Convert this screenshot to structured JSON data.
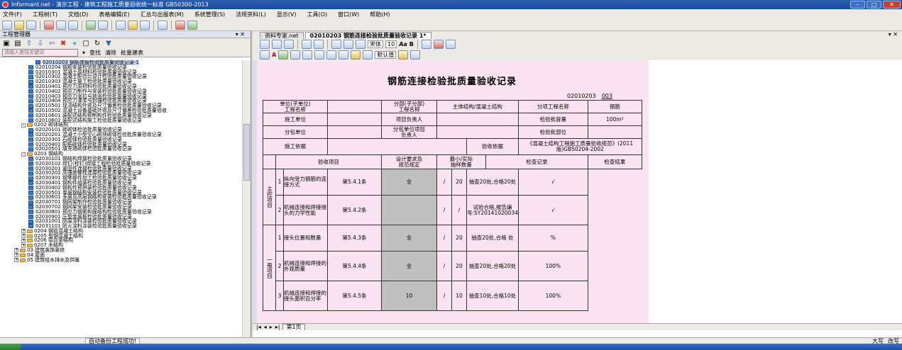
{
  "window": {
    "title": "Informant.net - 演示工程 - 建筑工程施工质量验收统一标准 GB50300-2013"
  },
  "menu": [
    "文件(F)",
    "工程树(T)",
    "文档(D)",
    "表格编辑(E)",
    "汇总与出报表(M)",
    "系统管理(S)",
    "法规资料(L)",
    "显示(V)",
    "工具(O)",
    "窗口(W)",
    "帮助(H)"
  ],
  "left": {
    "title": "工程管理器",
    "search_placeholder": "请输入查找关键词",
    "find_label": "查找",
    "clear_label": "清除",
    "batch_label": "批量建表",
    "tree": [
      {
        "t": "02010203  钢筋连接检验批质量验收记录-1",
        "lvl": 5,
        "sel": true,
        "k": "doc"
      },
      {
        "t": "02010204  钢筋安装检验批质量验收记录",
        "lvl": 4,
        "k": "doc"
      },
      {
        "t": "02010301  混凝土原材料检验批质量验收记录",
        "lvl": 4,
        "k": "doc"
      },
      {
        "t": "02010302  混凝土配合比设计检验批质量验收记录",
        "lvl": 4,
        "k": "doc"
      },
      {
        "t": "02010303  混凝土施工检验批质量验收记录",
        "lvl": 4,
        "k": "doc"
      },
      {
        "t": "02010401  预应力原材料检验批质量验收记录",
        "lvl": 4,
        "k": "doc"
      },
      {
        "t": "02010402  预应力制作与安装检验批质量验收记录",
        "lvl": 4,
        "k": "doc"
      },
      {
        "t": "02010403  预应力张拉与放张检验批质量验收记录",
        "lvl": 4,
        "k": "doc"
      },
      {
        "t": "02010404  预应力灌浆与封锚检验批质量验收记录",
        "lvl": 4,
        "k": "doc"
      },
      {
        "t": "02010501  现浇结构外观及尺寸偏差检验批质量验收记录",
        "lvl": 4,
        "k": "doc"
      },
      {
        "t": "02010502  混凝土设备基础外观及尺寸偏差检验批质量验收",
        "lvl": 4,
        "k": "doc"
      },
      {
        "t": "02010601  装配式结构预制构件检验批质量验收记录",
        "lvl": 4,
        "k": "doc"
      },
      {
        "t": "02010602  装配式结构施工检验批质量验收记录",
        "lvl": 4,
        "k": "doc"
      },
      {
        "t": "0202  砌体结构",
        "lvl": 3,
        "k": "folder",
        "pm": "-"
      },
      {
        "t": "02020101  砖砌体检验批质量验收记录",
        "lvl": 4,
        "k": "doc"
      },
      {
        "t": "02020201  混凝土小型空心砌块砌体检验批质量验收记录",
        "lvl": 4,
        "k": "doc"
      },
      {
        "t": "02020301  石砌体检验批质量验收记录",
        "lvl": 4,
        "k": "doc"
      },
      {
        "t": "02020401  配筋砌体检验批质量验收记录",
        "lvl": 4,
        "k": "doc"
      },
      {
        "t": "02020501  填充墙砌体检验批质量验收记录",
        "lvl": 4,
        "k": "doc"
      },
      {
        "t": "0203  钢结构",
        "lvl": 3,
        "k": "folder",
        "pm": "-"
      },
      {
        "t": "02030101  钢结构焊接检验批质量验收记录",
        "lvl": 4,
        "k": "doc"
      },
      {
        "t": "02030102  焊钉(栓钉)焊接工程检验批质量验收记录",
        "lvl": 4,
        "k": "doc"
      },
      {
        "t": "02030201  紧固件连接检验批质量验收记录",
        "lvl": 4,
        "k": "doc"
      },
      {
        "t": "02030202  高强度螺栓连接检验批质量验收记录",
        "lvl": 4,
        "k": "doc"
      },
      {
        "t": "02030301  钢零部件加工检验批质量验收记录",
        "lvl": 4,
        "k": "doc"
      },
      {
        "t": "02030401  钢构件组装检验批质量验收记录",
        "lvl": 4,
        "k": "doc"
      },
      {
        "t": "02030402  钢构件预拼装检验批质量验收记录",
        "lvl": 4,
        "k": "doc"
      },
      {
        "t": "02030501  单层钢结构安装检验批质量验收记录",
        "lvl": 4,
        "k": "doc"
      },
      {
        "t": "02030601  多层及高层钢结构安装检验批质量验收记录",
        "lvl": 4,
        "k": "doc"
      },
      {
        "t": "02030701  钢网架制作检验批质量验收记录",
        "lvl": 4,
        "k": "doc"
      },
      {
        "t": "02030702  钢网架安装检验批质量验收记录",
        "lvl": 4,
        "k": "doc"
      },
      {
        "t": "02030801  预应力钢索和膜结构检验批质量验收记录",
        "lvl": 4,
        "k": "doc"
      },
      {
        "t": "02030901  压型金属板检验批质量验收记录",
        "lvl": 4,
        "k": "doc"
      },
      {
        "t": "02031001  防腐涂料涂装检验批质量验收记录",
        "lvl": 4,
        "k": "doc"
      },
      {
        "t": "02031101  防火涂料涂装检验批质量验收记录",
        "lvl": 4,
        "k": "doc"
      },
      {
        "t": "0204  钢管混凝土结构",
        "lvl": 3,
        "k": "folder",
        "pm": "+"
      },
      {
        "t": "0205  型钢混凝土结构",
        "lvl": 3,
        "k": "folder",
        "pm": "+"
      },
      {
        "t": "0206  铝合金结构",
        "lvl": 3,
        "k": "folder",
        "pm": "+"
      },
      {
        "t": "0207  木结构",
        "lvl": 3,
        "k": "folder",
        "pm": "+"
      },
      {
        "t": "03  建筑装饰装修",
        "lvl": 2,
        "k": "folder",
        "pm": "+"
      },
      {
        "t": "04  屋面",
        "lvl": 2,
        "k": "folder",
        "pm": "+"
      },
      {
        "t": "05  建筑给水排水及供暖",
        "lvl": 2,
        "k": "folder",
        "pm": "+"
      }
    ]
  },
  "tabs": [
    "资料专家.net",
    "02010203  钢筋连接检验批质量验收记录 1*"
  ],
  "font": {
    "name": "宋体",
    "size": "10",
    "zoom": "默认值"
  },
  "form": {
    "title": "钢筋连接检验批质量验收记录",
    "code": "02010203",
    "code_no": "003",
    "unit_label": "单位(子单位)\n工程名称",
    "sub_label": "分部(子分部)\n工程名称",
    "sub_value": "主体结构/混凝土结构",
    "item_label": "分项工程名称",
    "item_value": "钢筋",
    "contractor_label": "施工单位",
    "pm_label": "项目负责人",
    "capacity_label": "检验批容量",
    "capacity_value": "100m²",
    "subcontract_label": "分包单位",
    "sub_pm_label": "分包单位项目\n负责人",
    "part_label": "检验批部位",
    "basis_label": "施工依据",
    "accept_label": "验收依据",
    "accept_value": "《混凝土结构工程施工质量验收规范》(2011版)GB50204-2002",
    "h_item": "验收项目",
    "h_design": "设计要求及\n规范规定",
    "h_sample": "最小/实际\n抽样数量",
    "h_record": "检查记录",
    "h_result": "检查结果",
    "main_group": "主控项目",
    "general_group": "一般项目",
    "rows": [
      {
        "no": "1",
        "item": "纵向受力钢筋的连接方式",
        "spec": "第5.4.1条",
        "min": "全",
        "slash": "/",
        "act": "20",
        "rec": "抽查20处,合格20处",
        "res": "√"
      },
      {
        "no": "2",
        "item": "机械连接和焊接接头的力学性能",
        "spec": "第5.4.2条",
        "min": "",
        "slash": "/",
        "act": "/",
        "rec": "试验合格,报告编号:SY20141020034",
        "res": "√"
      },
      {
        "no": "1",
        "item": "接头位置和数量",
        "spec": "第5.4.3条",
        "min": "全",
        "slash": "/",
        "act": "20",
        "rec": "抽查20处,合格  处",
        "res": "%"
      },
      {
        "no": "2",
        "item": "机械连接和焊接的外观质量",
        "spec": "第5.4.4条",
        "min": "全",
        "slash": "/",
        "act": "20",
        "rec": "抽查20处,合格20处",
        "res": "100%"
      },
      {
        "no": "3",
        "item": "机械连接和焊接的接头面积百分率",
        "spec": "第5.4.5条",
        "min": "10",
        "slash": "/",
        "act": "10",
        "rec": "抽查10处,合格10处",
        "res": "100%"
      }
    ]
  },
  "sheet_tab": "第1页",
  "status": {
    "text": "自动备份工程成功!",
    "caps": "大写",
    "mode": "改写"
  }
}
